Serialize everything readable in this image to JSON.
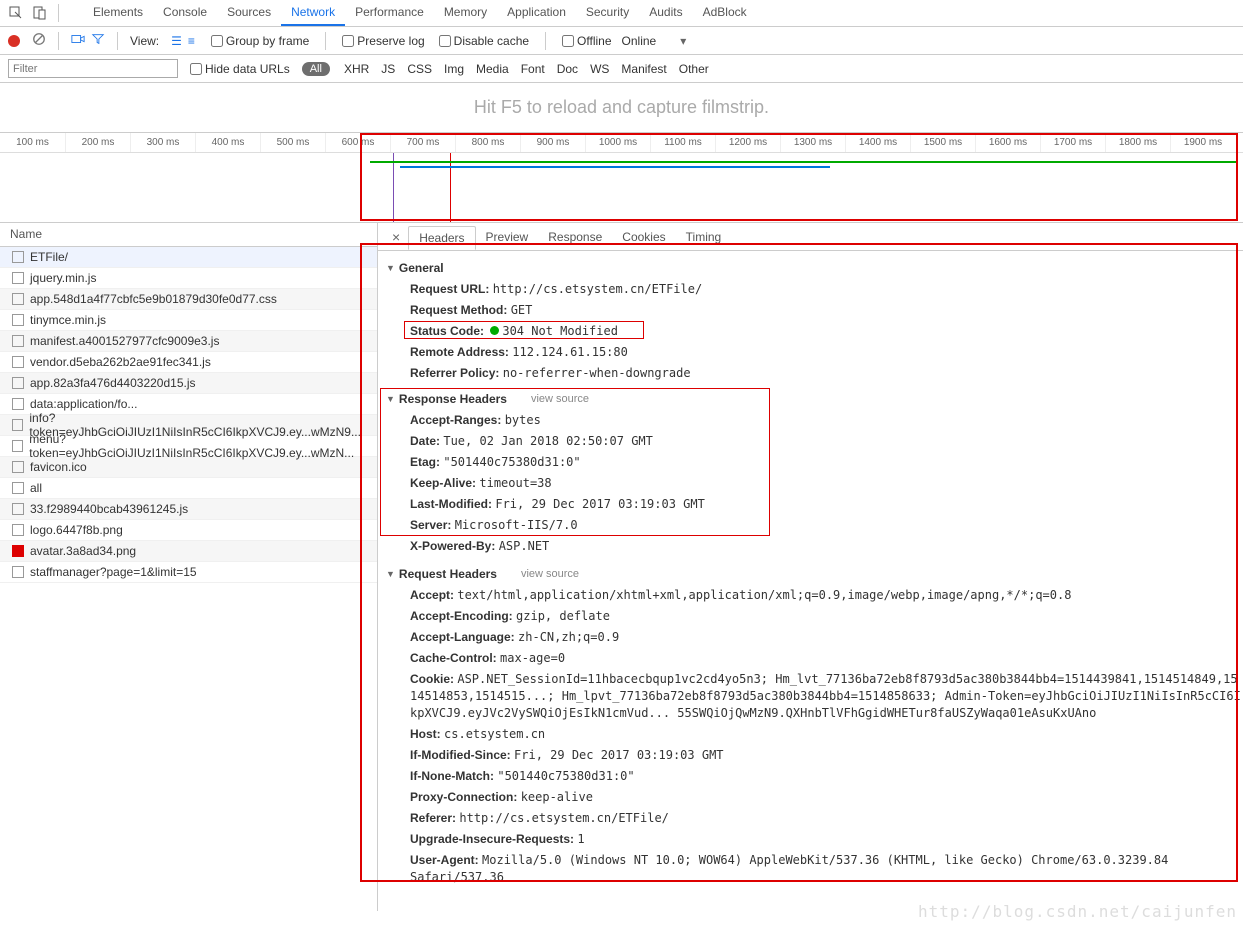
{
  "mainTabs": [
    "Elements",
    "Console",
    "Sources",
    "Network",
    "Performance",
    "Memory",
    "Application",
    "Security",
    "Audits",
    "AdBlock"
  ],
  "activeMainTab": "Network",
  "subbar": {
    "viewLabel": "View:",
    "groupByFrame": "Group by frame",
    "preserveLog": "Preserve log",
    "disableCache": "Disable cache",
    "offline": "Offline",
    "online": "Online"
  },
  "filterbar": {
    "placeholder": "Filter",
    "hideData": "Hide data URLs",
    "all": "All",
    "types": [
      "XHR",
      "JS",
      "CSS",
      "Img",
      "Media",
      "Font",
      "Doc",
      "WS",
      "Manifest",
      "Other"
    ]
  },
  "filmstrip": "Hit F5 to reload and capture filmstrip.",
  "ticks": [
    "100 ms",
    "200 ms",
    "300 ms",
    "400 ms",
    "500 ms",
    "600 ms",
    "700 ms",
    "800 ms",
    "900 ms",
    "1000 ms",
    "1100 ms",
    "1200 ms",
    "1300 ms",
    "1400 ms",
    "1500 ms",
    "1600 ms",
    "1700 ms",
    "1800 ms",
    "1900 ms"
  ],
  "nameHeader": "Name",
  "files": [
    "ETFile/",
    "jquery.min.js",
    "app.548d1a4f77cbfc5e9b01879d30fe0d77.css",
    "tinymce.min.js",
    "manifest.a4001527977cfc9009e3.js",
    "vendor.d5eba262b2ae91fec341.js",
    "app.82a3fa476d4403220d15.js",
    "data:application/fo...",
    "info?token=eyJhbGciOiJIUzI1NiIsInR5cCI6IkpXVCJ9.ey...wMzN9...",
    "menu?token=eyJhbGciOiJIUzI1NiIsInR5cCI6IkpXVCJ9.ey...wMzN...",
    "favicon.ico",
    "all",
    "33.f2989440bcab43961245.js",
    "logo.6447f8b.png",
    "avatar.3a8ad34.png",
    "staffmanager?page=1&limit=15"
  ],
  "detailTabs": [
    "Headers",
    "Preview",
    "Response",
    "Cookies",
    "Timing"
  ],
  "activeDetailTab": "Headers",
  "general": {
    "title": "General",
    "url_k": "Request URL:",
    "url_v": "http://cs.etsystem.cn/ETFile/",
    "method_k": "Request Method:",
    "method_v": "GET",
    "status_k": "Status Code:",
    "status_v": "304 Not Modified",
    "remote_k": "Remote Address:",
    "remote_v": "112.124.61.15:80",
    "refpol_k": "Referrer Policy:",
    "refpol_v": "no-referrer-when-downgrade"
  },
  "respHead": {
    "title": "Response Headers",
    "src": "view source",
    "accr_k": "Accept-Ranges:",
    "accr_v": "bytes",
    "date_k": "Date:",
    "date_v": "Tue, 02 Jan 2018 02:50:07 GMT",
    "etag_k": "Etag:",
    "etag_v": "\"501440c75380d31:0\"",
    "ka_k": "Keep-Alive:",
    "ka_v": "timeout=38",
    "lm_k": "Last-Modified:",
    "lm_v": "Fri, 29 Dec 2017 03:19:03 GMT",
    "srv_k": "Server:",
    "srv_v": "Microsoft-IIS/7.0",
    "xp_k": "X-Powered-By:",
    "xp_v": "ASP.NET"
  },
  "reqHead": {
    "title": "Request Headers",
    "src": "view source",
    "acc_k": "Accept:",
    "acc_v": "text/html,application/xhtml+xml,application/xml;q=0.9,image/webp,image/apng,*/*;q=0.8",
    "ae_k": "Accept-Encoding:",
    "ae_v": "gzip, deflate",
    "al_k": "Accept-Language:",
    "al_v": "zh-CN,zh;q=0.9",
    "cc_k": "Cache-Control:",
    "cc_v": "max-age=0",
    "ck_k": "Cookie:",
    "ck_v": "ASP.NET_SessionId=11hbacecbqup1vc2cd4yo5n3; Hm_lvt_77136ba72eb8f8793d5ac380b3844bb4=1514439841,1514514849,1514514853,1514515...; Hm_lpvt_77136ba72eb8f8793d5ac380b3844bb4=1514858633; Admin-Token=eyJhbGciOiJIUzI1NiIsInR5cCI6IkpXVCJ9.eyJVc2VySWQiOjEsIkN1cmVud... 55SWQiOjQwMzN9.QXHnbTlVFhGgidWHETur8faUSZyWaqa01eAsuKxUAno",
    "host_k": "Host:",
    "host_v": "cs.etsystem.cn",
    "ims_k": "If-Modified-Since:",
    "ims_v": "Fri, 29 Dec 2017 03:19:03 GMT",
    "inm_k": "If-None-Match:",
    "inm_v": "\"501440c75380d31:0\"",
    "pc_k": "Proxy-Connection:",
    "pc_v": "keep-alive",
    "ref_k": "Referer:",
    "ref_v": "http://cs.etsystem.cn/ETFile/",
    "uir_k": "Upgrade-Insecure-Requests:",
    "uir_v": "1",
    "ua_k": "User-Agent:",
    "ua_v": "Mozilla/5.0 (Windows NT 10.0; WOW64) AppleWebKit/537.36 (KHTML, like Gecko) Chrome/63.0.3239.84 Safari/537.36"
  },
  "watermark": "http://blog.csdn.net/caijunfen"
}
